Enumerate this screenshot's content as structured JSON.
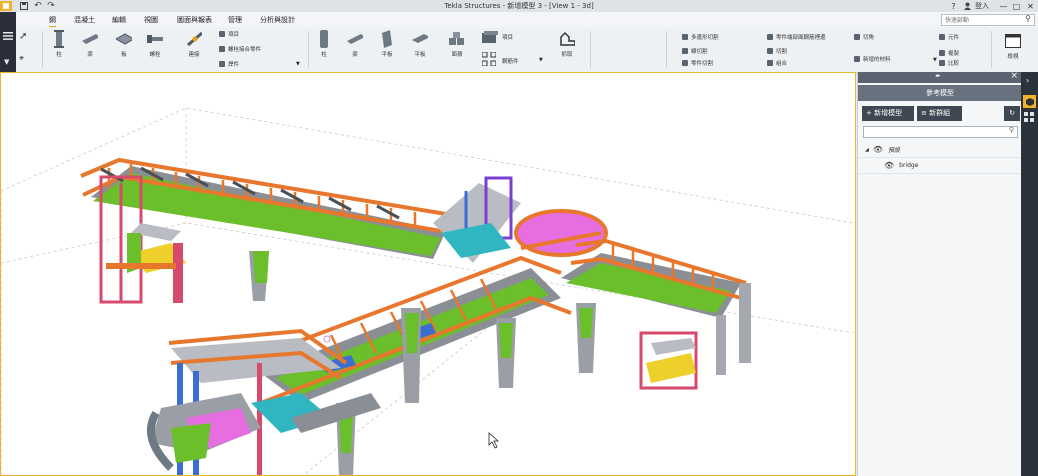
{
  "window": {
    "title": "Tekla Structures - 新增模型 3 - [View 1 - 3d]",
    "help": "?",
    "login": "登入",
    "minimize": "—",
    "maximize": "□",
    "close": "✕"
  },
  "search": {
    "placeholder": "快速啟動"
  },
  "menu": [
    "鋼",
    "混凝土",
    "編輯",
    "視圖",
    "圖面與報表",
    "管理",
    "分析與設計"
  ],
  "ribbon": {
    "steel": [
      {
        "label": "柱",
        "icon": "steel-column-icon"
      },
      {
        "label": "梁",
        "icon": "steel-beam-icon"
      },
      {
        "label": "板",
        "icon": "steel-plate-icon"
      },
      {
        "label": "螺栓",
        "icon": "bolt-icon"
      },
      {
        "label": "連接",
        "icon": "connection-icon"
      }
    ],
    "small_steel": [
      "項目",
      "螺栓接合零件",
      "焊件"
    ],
    "concrete": [
      {
        "label": "柱",
        "icon": "concrete-column-icon"
      },
      {
        "label": "梁",
        "icon": "concrete-beam-icon"
      },
      {
        "label": "平板",
        "icon": "concrete-slab-icon"
      },
      {
        "label": "平板",
        "icon": "concrete-panel-icon"
      },
      {
        "label": "面積",
        "icon": "area-icon"
      }
    ],
    "detail_top": "項目",
    "detail_big": "鋼筋件",
    "grip": "抓取",
    "edit_col1": [
      "多邊形切割",
      "線切割",
      "零件切割"
    ],
    "edit_col2": [
      "零件端部面鋼筋裡邊",
      "切割",
      "組合"
    ],
    "edit_col3": [
      "切角",
      "新增的材料"
    ],
    "edit_col4": [
      "元件",
      "複製",
      "比較"
    ],
    "view_btn": "檢視"
  },
  "panel": {
    "title": "參考模型",
    "add_model": "+ 新增模型",
    "new_group": "≡ 新群組",
    "tree_group": "預設",
    "tree_item": "bridge"
  }
}
